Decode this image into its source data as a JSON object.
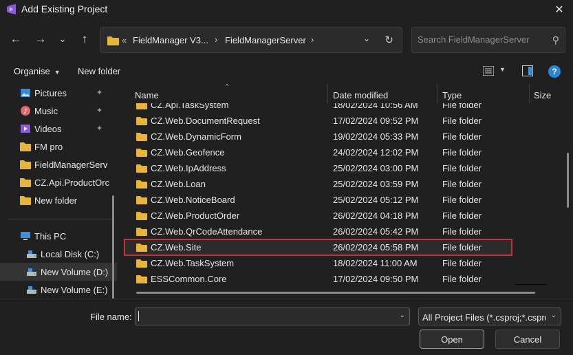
{
  "window": {
    "title": "Add Existing Project",
    "close_glyph": "✕",
    "app_icon": "visual-studio-icon"
  },
  "nav": {
    "back_glyph": "←",
    "forward_glyph": "→",
    "recent_glyph": "⌄",
    "up_glyph": "↑",
    "address": {
      "overflow": "«",
      "crumbs": [
        "FieldManager V3...",
        "FieldManagerServer"
      ],
      "sep_glyph": "›",
      "dropdown_glyph": "⌄",
      "refresh_glyph": "↻"
    },
    "search_placeholder": "Search FieldManagerServer",
    "search_glyph": "⚲"
  },
  "toolbar": {
    "organise_label": "Organise",
    "new_folder_label": "New folder",
    "help_label": "?"
  },
  "sidebar": {
    "items": [
      {
        "label": "Pictures",
        "icon": "pictures-icon",
        "pinned": true
      },
      {
        "label": "Music",
        "icon": "music-icon",
        "pinned": true
      },
      {
        "label": "Videos",
        "icon": "videos-icon",
        "pinned": true
      },
      {
        "label": "FM pro",
        "icon": "folder-icon",
        "pinned": false
      },
      {
        "label": "FieldManagerServ",
        "icon": "folder-icon",
        "pinned": false
      },
      {
        "label": "CZ.Api.ProductOrc",
        "icon": "folder-icon",
        "pinned": false
      },
      {
        "label": "New folder",
        "icon": "folder-icon",
        "pinned": false
      },
      {
        "label": "This PC",
        "icon": "this-pc-icon",
        "pinned": false
      },
      {
        "label": "Local Disk (C:)",
        "icon": "drive-icon",
        "pinned": false
      },
      {
        "label": "New Volume (D:)",
        "icon": "drive-icon",
        "pinned": false
      },
      {
        "label": "New Volume (E:)",
        "icon": "drive-icon",
        "pinned": false
      }
    ],
    "pin_glyph": "📌"
  },
  "columns": {
    "name": "Name",
    "date": "Date modified",
    "type": "Type",
    "size": "Size",
    "sort_glyph": "^"
  },
  "files": [
    {
      "name": "CZ.Api.TaskSystem",
      "date": "18/02/2024 10:56 AM",
      "type": "File folder"
    },
    {
      "name": "CZ.Web.DocumentRequest",
      "date": "17/02/2024 09:52 PM",
      "type": "File folder"
    },
    {
      "name": "CZ.Web.DynamicForm",
      "date": "19/02/2024 05:33 PM",
      "type": "File folder"
    },
    {
      "name": "CZ.Web.Geofence",
      "date": "24/02/2024 12:02 PM",
      "type": "File folder"
    },
    {
      "name": "CZ.Web.IpAddress",
      "date": "25/02/2024 03:00 PM",
      "type": "File folder"
    },
    {
      "name": "CZ.Web.Loan",
      "date": "25/02/2024 03:59 PM",
      "type": "File folder"
    },
    {
      "name": "CZ.Web.NoticeBoard",
      "date": "25/02/2024 05:12 PM",
      "type": "File folder"
    },
    {
      "name": "CZ.Web.ProductOrder",
      "date": "26/02/2024 04:18 PM",
      "type": "File folder"
    },
    {
      "name": "CZ.Web.QrCodeAttendance",
      "date": "26/02/2024 05:42 PM",
      "type": "File folder"
    },
    {
      "name": "CZ.Web.Site",
      "date": "26/02/2024 05:58 PM",
      "type": "File folder"
    },
    {
      "name": "CZ.Web.TaskSystem",
      "date": "18/02/2024 11:00 AM",
      "type": "File folder"
    },
    {
      "name": "ESSCommon.Core",
      "date": "17/02/2024 09:50 PM",
      "type": "File folder"
    }
  ],
  "bottom": {
    "file_name_label": "File name:",
    "file_name_value": "",
    "filter_value": "All Project Files (*.csproj;*.csprc",
    "dropdown_glyph": "⌄",
    "open_label": "Open",
    "cancel_label": "Cancel"
  },
  "colors": {
    "folder": "#e8b53a",
    "selection_outline": "#c0363a",
    "help": "#2a86d8"
  }
}
